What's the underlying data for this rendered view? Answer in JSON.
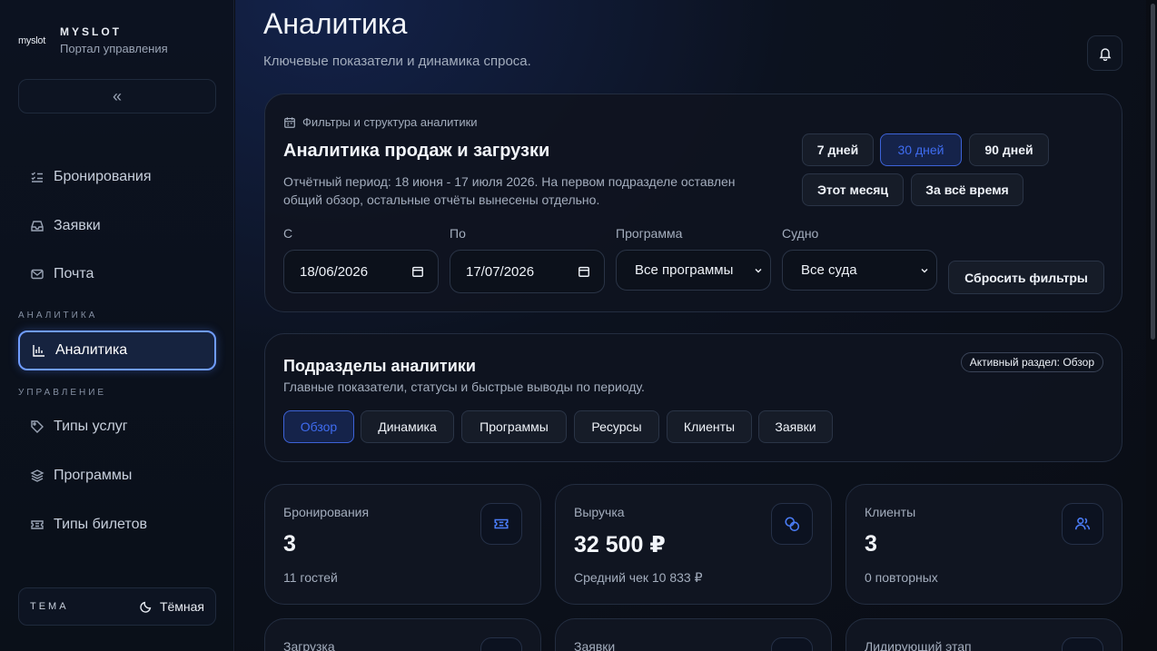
{
  "brand": {
    "logo": "myslot",
    "name": "MYSLOT",
    "subtitle": "Портал управления"
  },
  "sidebar": {
    "collapse_label": "«",
    "items": [
      {
        "label": "Бронирования",
        "icon": "checklist-icon"
      },
      {
        "label": "Заявки",
        "icon": "inbox-icon"
      },
      {
        "label": "Почта",
        "icon": "mail-icon"
      },
      {
        "label": "Аналитика",
        "icon": "bar-chart-icon"
      },
      {
        "label": "Типы услуг",
        "icon": "tag-icon"
      },
      {
        "label": "Программы",
        "icon": "layers-icon"
      },
      {
        "label": "Типы билетов",
        "icon": "ticket-icon"
      }
    ],
    "sections": [
      "АНАЛИТИКА",
      "УПРАВЛЕНИЕ"
    ],
    "theme_label": "ТЕМА",
    "theme_value": "Тёмная"
  },
  "header": {
    "title": "Аналитика",
    "subtitle": "Ключевые показатели и динамика спроса."
  },
  "filters": {
    "head": "Фильтры и структура аналитики",
    "title": "Аналитика продаж и загрузки",
    "description": "Отчётный период: 18 июня - 17 июля 2026. На первом подразделе оставлен общий обзор, остальные отчёты вынесены отдельно.",
    "periods": [
      "7 дней",
      "30 дней",
      "90 дней",
      "Этот месяц",
      "За всё время"
    ],
    "active_period": "30 дней",
    "from_label": "С",
    "from_value": "18/06/2026",
    "to_label": "По",
    "to_value": "17/07/2026",
    "program_label": "Программа",
    "program_value": "Все программы",
    "vessel_label": "Судно",
    "vessel_value": "Все суда",
    "reset_label": "Сбросить фильтры"
  },
  "sections": {
    "title": "Подразделы аналитики",
    "description": "Главные показатели, статусы и быстрые выводы по периоду.",
    "badge": "Активный раздел: Обзор",
    "tabs": [
      "Обзор",
      "Динамика",
      "Программы",
      "Ресурсы",
      "Клиенты",
      "Заявки"
    ],
    "active_tab": "Обзор"
  },
  "stats": [
    {
      "label": "Бронирования",
      "value": "3",
      "sub": "11 гостей",
      "icon": "ticket-icon"
    },
    {
      "label": "Выручка",
      "value": "32 500 ₽",
      "sub": "Средний чек 10 833 ₽",
      "icon": "coins-icon"
    },
    {
      "label": "Клиенты",
      "value": "3",
      "sub": "0 повторных",
      "icon": "users-icon"
    }
  ],
  "stats_row2": [
    {
      "label": "Загрузка"
    },
    {
      "label": "Заявки"
    },
    {
      "label": "Лидирующий этап"
    }
  ],
  "colors": {
    "accent": "#3f6cf0",
    "active_border": "#6f9cff",
    "background": "#0a0d14"
  }
}
